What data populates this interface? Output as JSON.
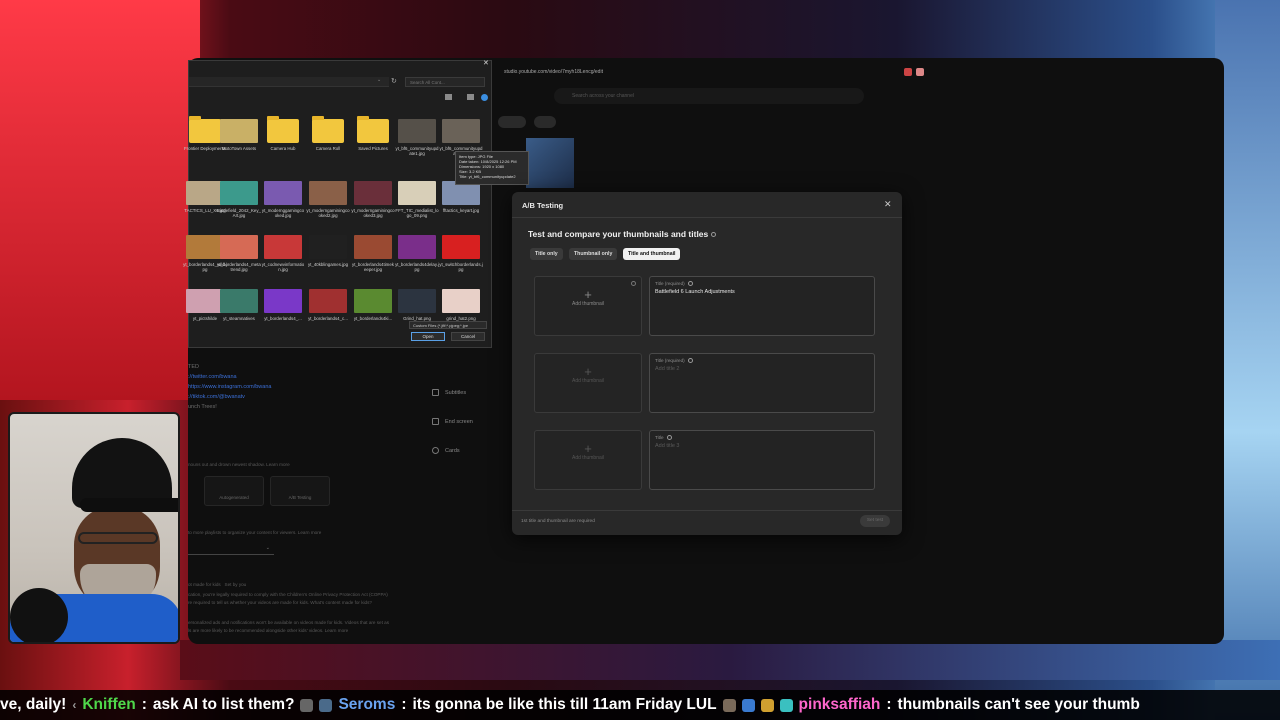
{
  "browser": {
    "url": "studio.youtube.com/video/7myh18Lencg/edit",
    "search_placeholder": "Search across your channel"
  },
  "studio_menu": [
    "Subtitles",
    "End screen",
    "Cards"
  ],
  "studio_text": {
    "desc_lines": [
      "TED",
      "://twitter.com/bwana",
      "https://www.instagram.com/bwana",
      "://tiktok.com/@bwanatv",
      "unch Trees!"
    ],
    "line1": "nouns out and drown newest shadow. Learn more",
    "card1": "Autogenerated",
    "card2": "A/B Testing",
    "line2": "to more playlists to organize your content for viewers. Learn more",
    "line3_a": "ot made for kids",
    "line3_b": "Set by you",
    "line4": "cation, you're legally required to comply with the Children's Online Privacy Protection Act (COPPA)",
    "line5": "re required to tell us whether your videos are made for kids. What's content made for kids?",
    "line6": "ersonalized ads and notifications won't be available on videos made for kids. Videos that are set as",
    "line7": "ls are more likely to be recommended alongside other kids' videos. Learn more"
  },
  "file_dialog": {
    "search_placeholder": "Search All Cont...",
    "files": [
      {
        "label": "Frontier Deployments",
        "kind": "folder"
      },
      {
        "label": "MotoTown Assets",
        "kind": "thumb",
        "color": "#c9b066"
      },
      {
        "label": "Camera Hub",
        "kind": "folder"
      },
      {
        "label": "Camera Roll",
        "kind": "folder"
      },
      {
        "label": "Saved Pictures",
        "kind": "folder"
      },
      {
        "label": "yt_bf6_communityupdate1.jpg",
        "kind": "thumb",
        "color": "#555049"
      },
      {
        "label": "yt_bf6_communityupdate2.jpg",
        "kind": "thumb",
        "color": "#6a6258"
      },
      {
        "label": "TACTICS_LU_X6.jpg",
        "kind": "thumb",
        "color": "#b9a787"
      },
      {
        "label": "Battlefield_2042_Key_Art.jpg",
        "kind": "thumb",
        "color": "#3c9a8c"
      },
      {
        "label": "yt_modernggamingcooked.jpg",
        "kind": "thumb",
        "color": "#7a5ab0"
      },
      {
        "label": "yt_moderngaminingcooked2.jpg",
        "kind": "thumb",
        "color": "#8a6048"
      },
      {
        "label": "yt_moderngaminingcooked3.jpg",
        "kind": "thumb",
        "color": "#6a2f3a"
      },
      {
        "label": "FFT_TIC_medialist_logo_09.png",
        "kind": "thumb",
        "color": "#d8cfb8"
      },
      {
        "label": "fftactics_keyart.jpg",
        "kind": "thumb",
        "color": "#8090b0"
      },
      {
        "label": "yt_borderlands4_wild.jpg",
        "kind": "thumb",
        "color": "#b27a3a"
      },
      {
        "label": "yt_borderlands4_metatrend.jpg",
        "kind": "thumb",
        "color": "#d66a55"
      },
      {
        "label": "yt_codnewvinformation.jpg",
        "kind": "thumb",
        "color": "#c83838"
      },
      {
        "label": "yt_40kblingames.jpg",
        "kind": "thumb",
        "color": "#202020"
      },
      {
        "label": "yt_borderlands4timekeeper.jpg",
        "kind": "thumb",
        "color": "#9a4a32"
      },
      {
        "label": "yt_borderlands4delay.jpg",
        "kind": "thumb",
        "color": "#7a2e8a"
      },
      {
        "label": "yt_switchborderlands.jpg",
        "kind": "thumb",
        "color": "#d82020"
      },
      {
        "label": "yt_pictshilde",
        "kind": "thumb",
        "color": "#cfa0b0"
      },
      {
        "label": "yt_steamnatives",
        "kind": "thumb",
        "color": "#3a7a6a"
      },
      {
        "label": "yt_borderlands4_...",
        "kind": "thumb",
        "color": "#7a38c8"
      },
      {
        "label": "yt_borderlands4_c...",
        "kind": "thumb",
        "color": "#a03030"
      },
      {
        "label": "yt_borderlands4ki...",
        "kind": "thumb",
        "color": "#5a8a30"
      },
      {
        "label": "Grind_hat.png",
        "kind": "thumb",
        "color": "#2c3440"
      },
      {
        "label": "grind_hat2.png",
        "kind": "thumb",
        "color": "#e8d0c8"
      }
    ],
    "tooltip_lines": [
      "Item type: JPG File",
      "Date taken: 10/8/2025 12:26 PM",
      "Dimensions: 1920 x 1080",
      "Size: 3.2 KB",
      "Title: yt_bf6_communityupdate2"
    ],
    "filter": "Custom Files (*.jfif;*.pjpeg;*.jpe",
    "open": "Open",
    "cancel": "Cancel"
  },
  "modal": {
    "title": "A/B Testing",
    "subtitle": "Test and compare your thumbnails and titles",
    "tabs": [
      "Title only",
      "Thumbnail only",
      "Title and thumbnail"
    ],
    "rows": [
      {
        "add_label": "Add thumbnail",
        "title_label": "Title (required)",
        "title_value": "Battlefield 6 Launch Adjustments",
        "placeholder": ""
      },
      {
        "add_label": "Add thumbnail",
        "title_label": "Title (required)",
        "title_value": "",
        "placeholder": "Add title 2"
      },
      {
        "add_label": "Add thumbnail",
        "title_label": "Title",
        "title_value": "",
        "placeholder": "Add title 3"
      }
    ],
    "footer": "1st title and thumbnail are required",
    "set_test": "Set test"
  },
  "chat": {
    "msg1_tail": "ve, daily!",
    "name1": "Kniffen",
    "msg1": "ask AI to list them?",
    "name2": "Seroms",
    "msg2": "its gonna be like this till 11am Friday LUL",
    "name3": "pinksaffiah",
    "msg3": "thumbnails can't see your thumb"
  }
}
